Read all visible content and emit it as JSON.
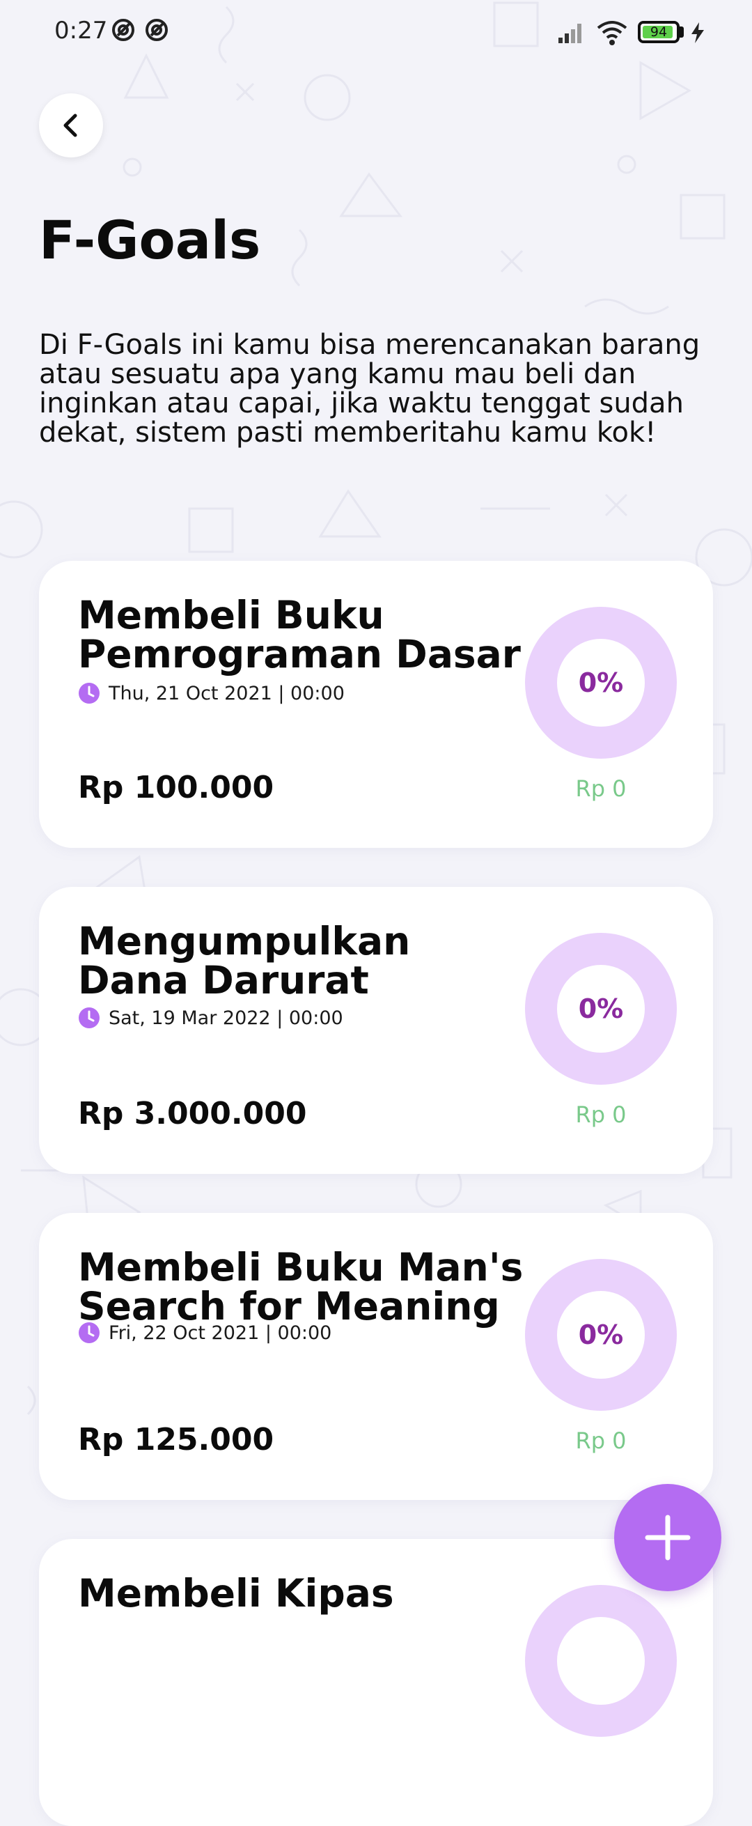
{
  "status_bar": {
    "time": "0:27",
    "battery_level": "94",
    "battery_fraction": 0.94
  },
  "header": {
    "title": "F-Goals",
    "description": "Di F-Goals ini kamu bisa merencanakan barang atau sesuatu apa yang kamu mau beli dan inginkan atau capai, jika waktu tenggat sudah dekat, sistem pasti memberitahu kamu kok!"
  },
  "goals": [
    {
      "title": "Membeli Buku Pemrograman Dasar",
      "deadline": "Thu, 21 Oct 2021 | 00:00",
      "target": "Rp 100.000",
      "progress_label": "0%",
      "progress": 0,
      "saved": "Rp 0"
    },
    {
      "title": "Mengumpulkan Dana Darurat",
      "deadline": "Sat, 19 Mar 2022 | 00:00",
      "target": "Rp 3.000.000",
      "progress_label": "0%",
      "progress": 0,
      "saved": "Rp 0"
    },
    {
      "title": "Membeli Buku Man's Search for Meaning",
      "deadline": "Fri, 22 Oct 2021 | 00:00",
      "target": "Rp 125.000",
      "progress_label": "0%",
      "progress": 0,
      "saved": "Rp 0"
    },
    {
      "title": "Membeli Kipas",
      "deadline": "",
      "target": "",
      "progress_label": "",
      "progress": 0,
      "saved": ""
    }
  ],
  "colors": {
    "accent": "#b46cf2",
    "ring": "#ead2fc",
    "progress_text": "#8a2a9e",
    "saved_text": "#79c98a",
    "clock_icon": "#b46cf2"
  },
  "icons": {
    "back": "chevron-left-icon",
    "deadline": "clock-icon",
    "add": "plus-icon"
  }
}
